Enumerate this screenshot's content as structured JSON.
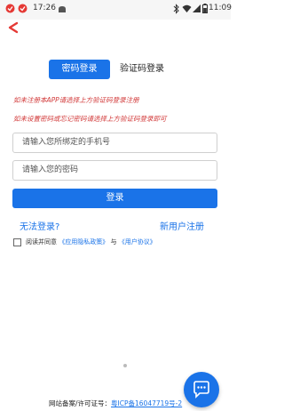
{
  "status_bar": {
    "time_left": "17:26",
    "time_right": "11:09"
  },
  "tabs": {
    "password_login": "密码登录",
    "code_login": "验证码登录"
  },
  "notices": {
    "line1": "如未注册本APP请选择上方验证码登录注册",
    "line2": "如未设置密码或忘记密码请选择上方验证码登录即可"
  },
  "form": {
    "phone_placeholder": "请输入您所绑定的手机号",
    "password_placeholder": "请输入您的密码",
    "login_label": "登录"
  },
  "links": {
    "cannot_login": "无法登录?",
    "register": "新用户注册"
  },
  "agreement": {
    "prefix": "阅读并同意",
    "privacy": "《应用隐私政策》",
    "and": "与",
    "user": "《用户协议》"
  },
  "footer": {
    "label": "网站备案/许可证号：",
    "icp": "粤ICP备16047719号-2"
  },
  "colors": {
    "accent": "#1a73e8",
    "notice": "#d23a3a"
  }
}
